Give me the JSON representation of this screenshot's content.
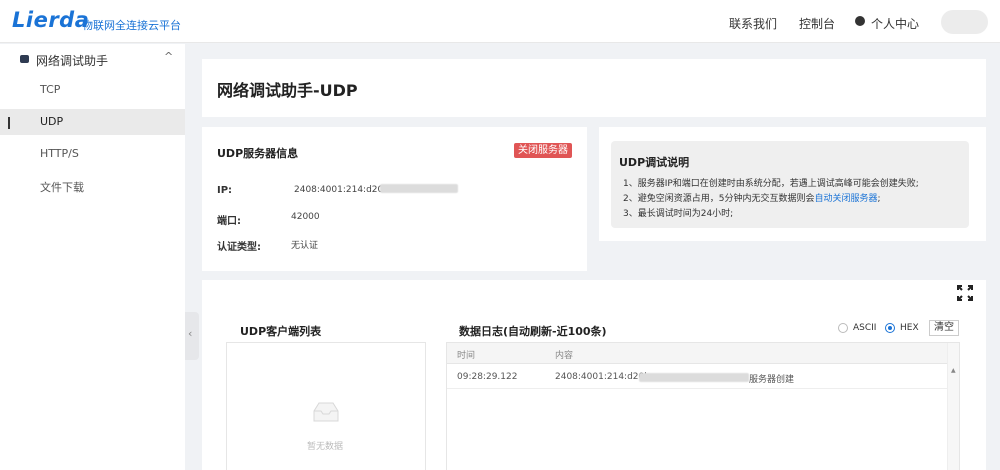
{
  "header": {
    "logo": "Lierda",
    "logo_subtitle": "物联网全连接云平台",
    "nav": [
      "联系我们",
      "控制台"
    ],
    "user_center": "个人中心"
  },
  "sidebar": {
    "group_label": "网络调试助手",
    "chevron": "^",
    "items": [
      {
        "label": "TCP",
        "active": false
      },
      {
        "label": "UDP",
        "active": true
      },
      {
        "label": "HTTP/S",
        "active": false
      },
      {
        "label": "文件下载",
        "active": false
      }
    ],
    "collapse_glyph": "‹"
  },
  "page": {
    "title": "网络调试助手-UDP"
  },
  "server_info": {
    "title": "UDP服务器信息",
    "close_button": "关闭服务器",
    "ip_label": "IP:",
    "ip_value": "2408:4001:214:d20b:",
    "port_label": "端口:",
    "port_value": "42000",
    "auth_label": "认证类型:",
    "auth_value": "无认证"
  },
  "description": {
    "title": "UDP调试说明",
    "line1": "1、服务器IP和端口在创建时由系统分配，若遇上调试高峰可能会创建失败;",
    "line2_prefix": "2、避免空闲资源占用，5分钟内无交互数据则会",
    "line2_link": "自动关闭服务器",
    "line2_suffix": ";",
    "line3": "3、最长调试时间为24小时;"
  },
  "clients": {
    "title": "UDP客户端列表",
    "empty_text": "暂无数据"
  },
  "log": {
    "title": "数据日志(自动刷新-近100条)",
    "format_options": [
      "ASCII",
      "HEX"
    ],
    "selected_format": "HEX",
    "clear_button": "清空",
    "columns": [
      "时间",
      "内容"
    ],
    "rows": [
      {
        "time": "09:28:29.122",
        "content_prefix": "2408:4001:214:d20b",
        "content_suffix": "服务器创建"
      }
    ]
  },
  "colors": {
    "accent": "#1a73d6",
    "danger": "#e05555",
    "background": "#f0f2f5"
  }
}
